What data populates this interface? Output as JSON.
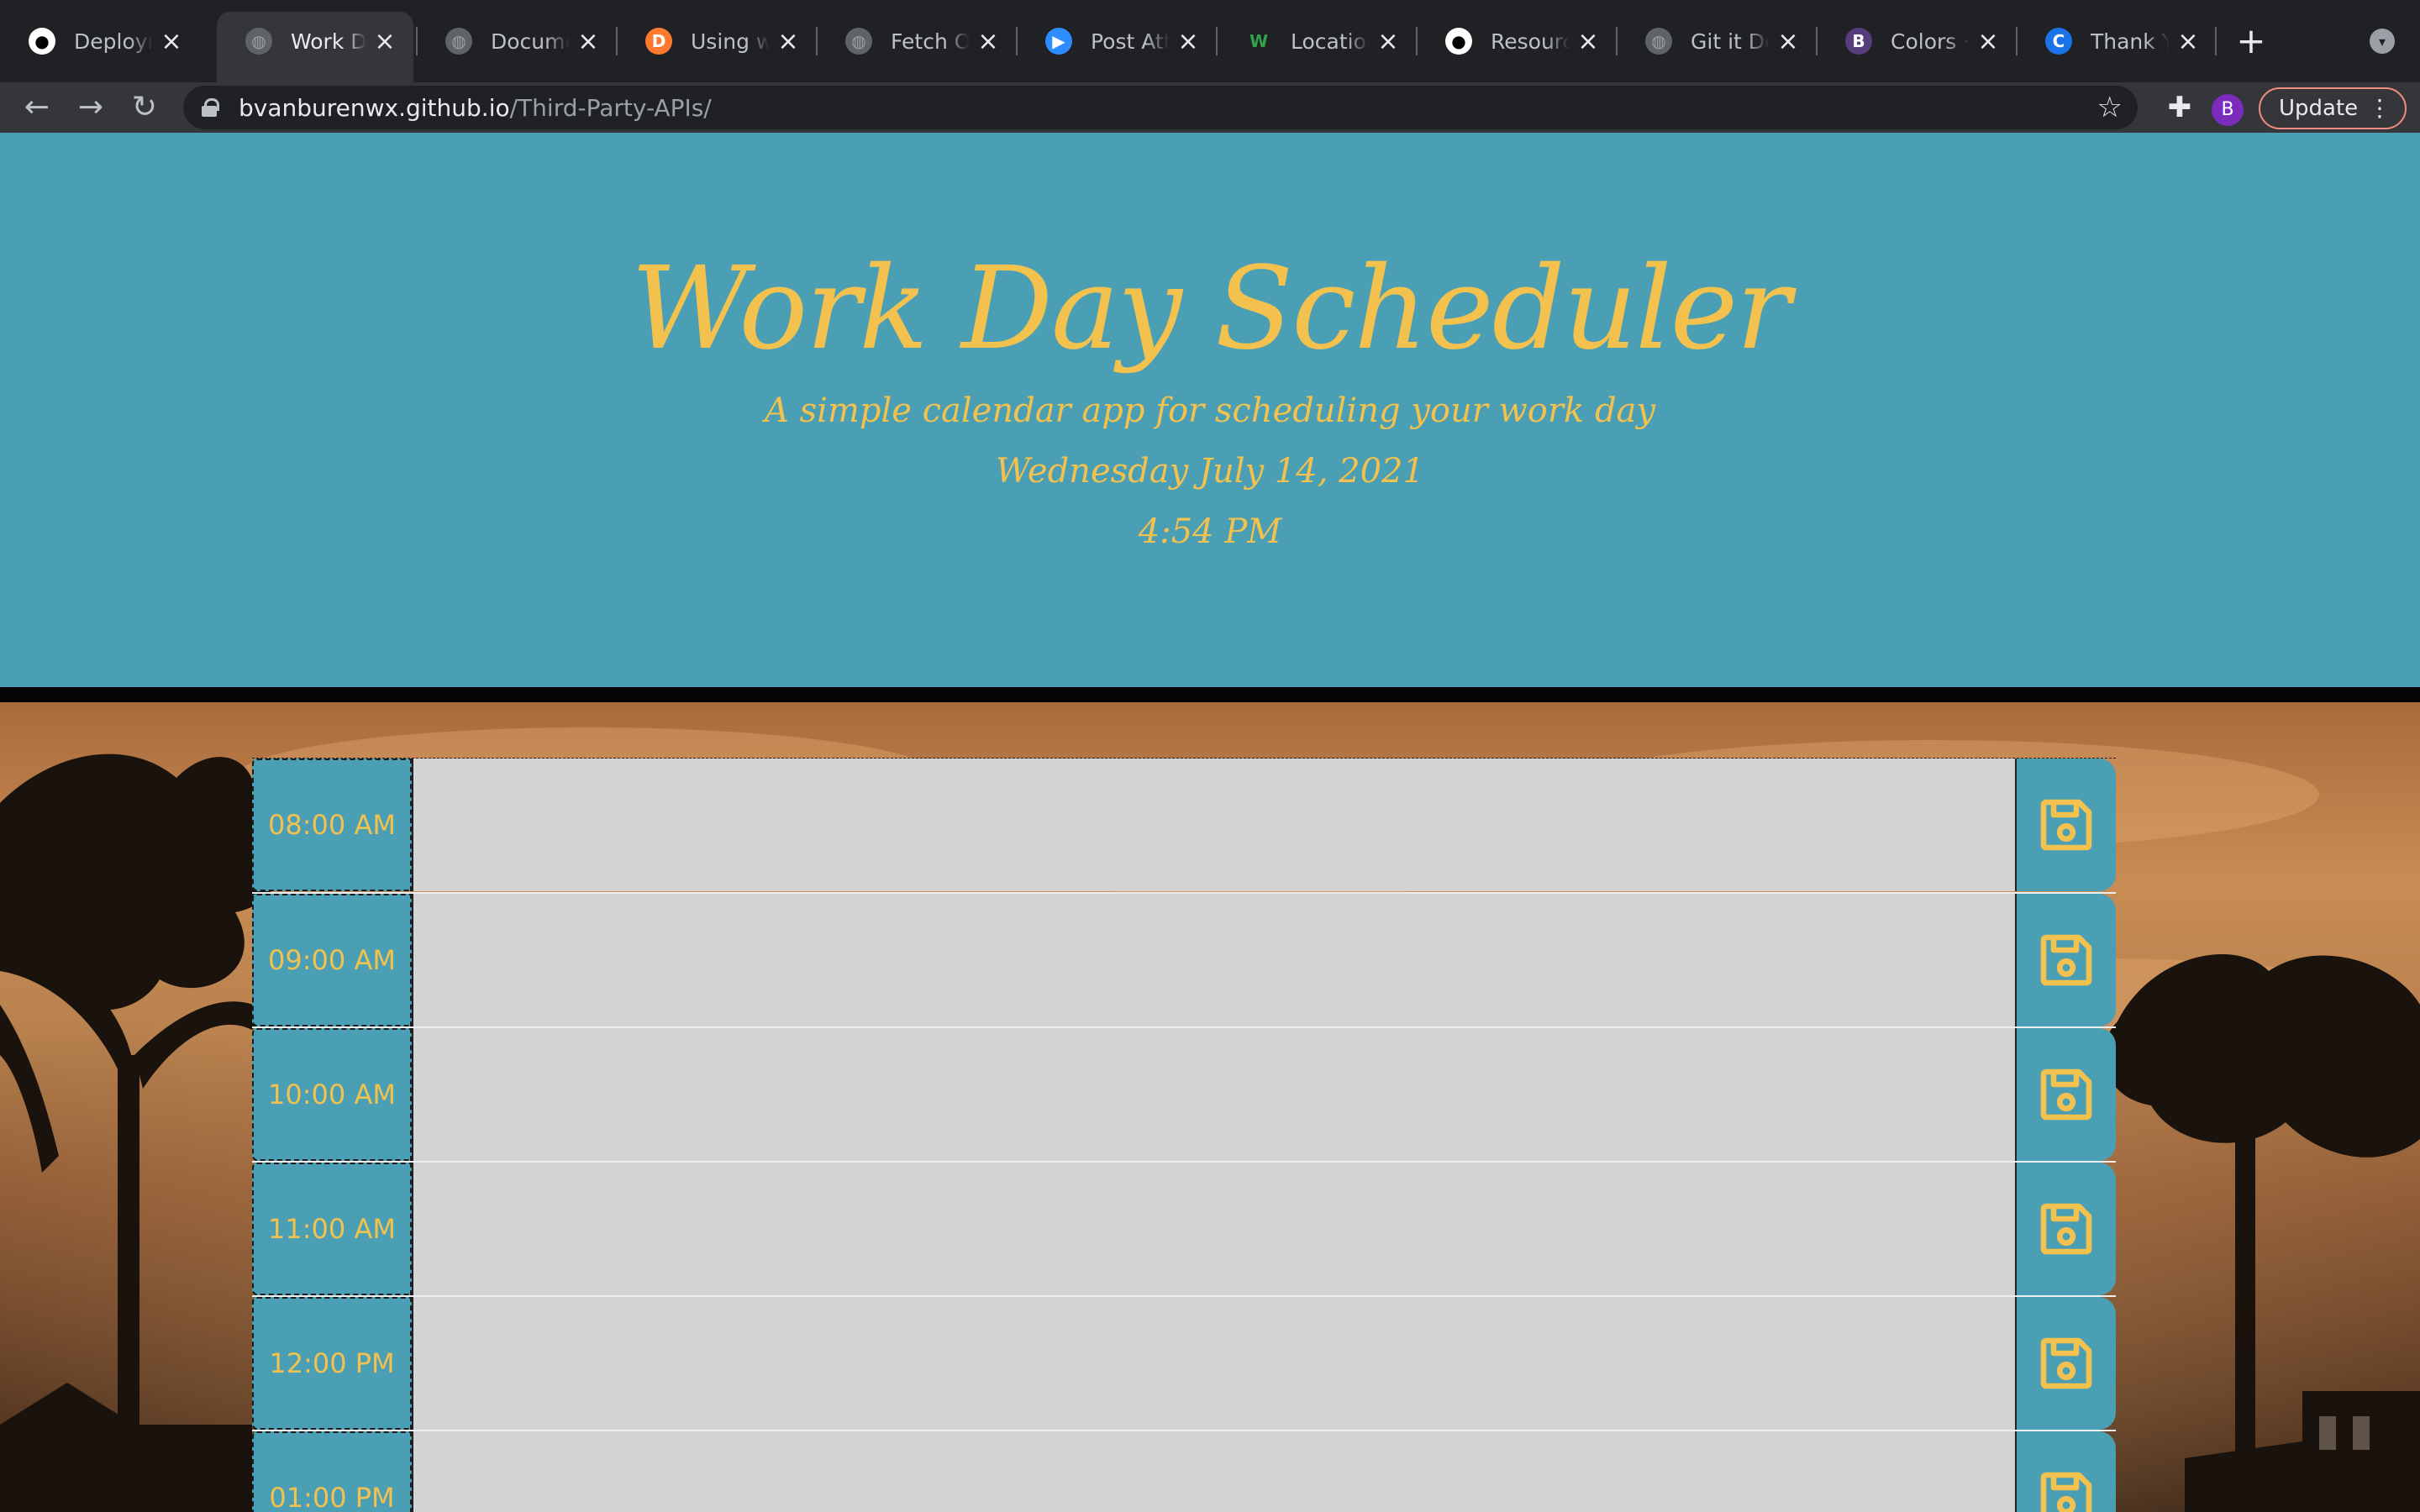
{
  "browser": {
    "tabs": [
      {
        "title": "Deployme",
        "icon": "github-icon",
        "active": false
      },
      {
        "title": "Work Day",
        "icon": "globe-icon",
        "active": true
      },
      {
        "title": "Documen",
        "icon": "globe-icon",
        "active": false
      },
      {
        "title": "Using win",
        "icon": "codepen-icon",
        "active": false
      },
      {
        "title": "Fetch Op",
        "icon": "globe-icon",
        "active": false
      },
      {
        "title": "Post Atte",
        "icon": "zoom-icon",
        "active": false
      },
      {
        "title": "Location",
        "icon": "w-icon",
        "active": false
      },
      {
        "title": "Resource",
        "icon": "github-icon",
        "active": false
      },
      {
        "title": "Git it Don",
        "icon": "globe-icon",
        "active": false
      },
      {
        "title": "Colors · B",
        "icon": "bootstrap-icon",
        "active": false
      },
      {
        "title": "Thank Yo",
        "icon": "c-icon",
        "active": false
      }
    ],
    "url_host": "bvanburenwx.github.io",
    "url_path": "/Third-Party-APIs/",
    "profile_initial": "B",
    "update_label": "Update"
  },
  "header": {
    "title": "Work Day Scheduler",
    "subtitle": "A simple calendar app for scheduling your work day",
    "date": "Wednesday July 14, 2021",
    "time": "4:54 PM"
  },
  "schedule": [
    {
      "hour": "08:00 AM",
      "text": ""
    },
    {
      "hour": "09:00 AM",
      "text": ""
    },
    {
      "hour": "10:00 AM",
      "text": ""
    },
    {
      "hour": "11:00 AM",
      "text": ""
    },
    {
      "hour": "12:00 PM",
      "text": ""
    },
    {
      "hour": "01:00 PM",
      "text": ""
    }
  ],
  "colors": {
    "accent": "#4a9fb5",
    "text_gold": "#f2c14e",
    "textarea": "#d3d3d3"
  }
}
